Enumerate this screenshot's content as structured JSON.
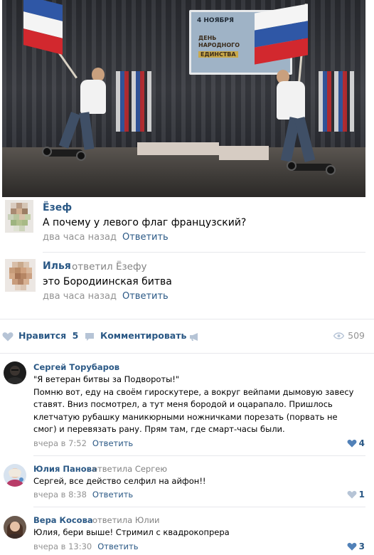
{
  "photo": {
    "screen_lines": [
      "4 НОЯБРЯ",
      "ДЕНЬ",
      "НАРОДНОГО",
      "ЕДИНСТВА"
    ]
  },
  "comments_top": [
    {
      "author": "Ёзеф",
      "text": "А почему у левого флаг французский?",
      "time": "два часа назад",
      "reply_label": "Ответить"
    },
    {
      "author": "Илья",
      "reply_to": "ответил Ёзефу",
      "text": "это Бородиинская битва",
      "time": "два часа назад",
      "reply_label": "Ответить"
    }
  ],
  "actions": {
    "like_label": "Нравится",
    "like_count": "5",
    "comment_label": "Комментировать",
    "views": "509"
  },
  "comments_bottom": [
    {
      "author": "Сергей Торубаров",
      "text_lines": [
        "\"Я ветеран битвы за Подвороты!\"",
        "Помню вот, еду на своём гироскутере, а вокруг вейпами дымовую завесу",
        "ставят. Вниз посмотрел, а тут меня бородой и оцарапало. Пришлось",
        "клетчатую рубашку маникюрными ножничками порезать (порвать не",
        "смог) и перевязать рану. Прям там, где смарт-часы были."
      ],
      "time": "вчера в 7:52",
      "reply_label": "Ответить",
      "likes": "4"
    },
    {
      "author": "Юлия Панова",
      "reply_to": "ответила Сергею",
      "text": "Сергей, все действо селфил на айфон!!",
      "time": "вчера в 8:38",
      "reply_label": "Ответить",
      "likes": "1"
    },
    {
      "author": "Вера Косова",
      "reply_to": "ответила Юлии",
      "text": "Юлия, бери выше! Стримил с квадрокопрера",
      "time": "вчера в 13:30",
      "reply_label": "Ответить",
      "likes": "3"
    }
  ],
  "colors": {
    "link": "#2a5885",
    "meta": "#939393",
    "divider": "#e7e8ec"
  }
}
